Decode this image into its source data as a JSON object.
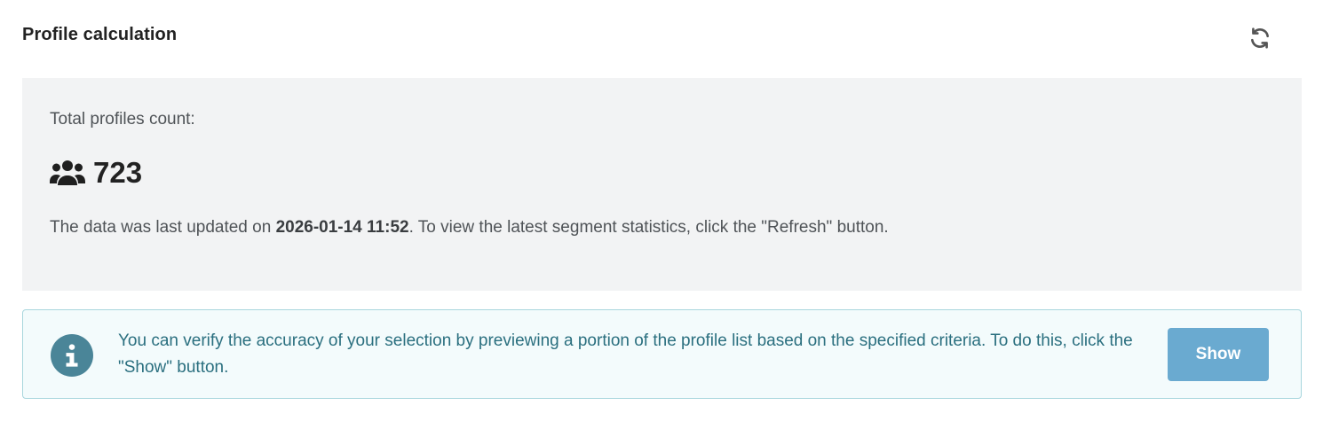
{
  "header": {
    "title": "Profile calculation",
    "refresh_icon": "refresh-icon"
  },
  "stats": {
    "label": "Total profiles count:",
    "count": "723",
    "users_icon": "users-icon",
    "updated_prefix": "The data was last updated on ",
    "updated_datetime": "2026-01-14 11:52",
    "updated_suffix": ". To view the latest segment statistics, click the \"Refresh\" button."
  },
  "info": {
    "icon": "info-icon",
    "text": "You can verify the accuracy of your selection by previewing a portion of the profile list based on the specified criteria. To do this, click the \"Show\" button.",
    "button_label": "Show"
  },
  "colors": {
    "stats_bg": "#f2f3f4",
    "info_bg": "#f3fbfc",
    "info_border": "#a8d6dd",
    "info_text": "#2a6f7f",
    "info_icon_bg": "#4a8598",
    "button_bg": "#6aaad0"
  }
}
